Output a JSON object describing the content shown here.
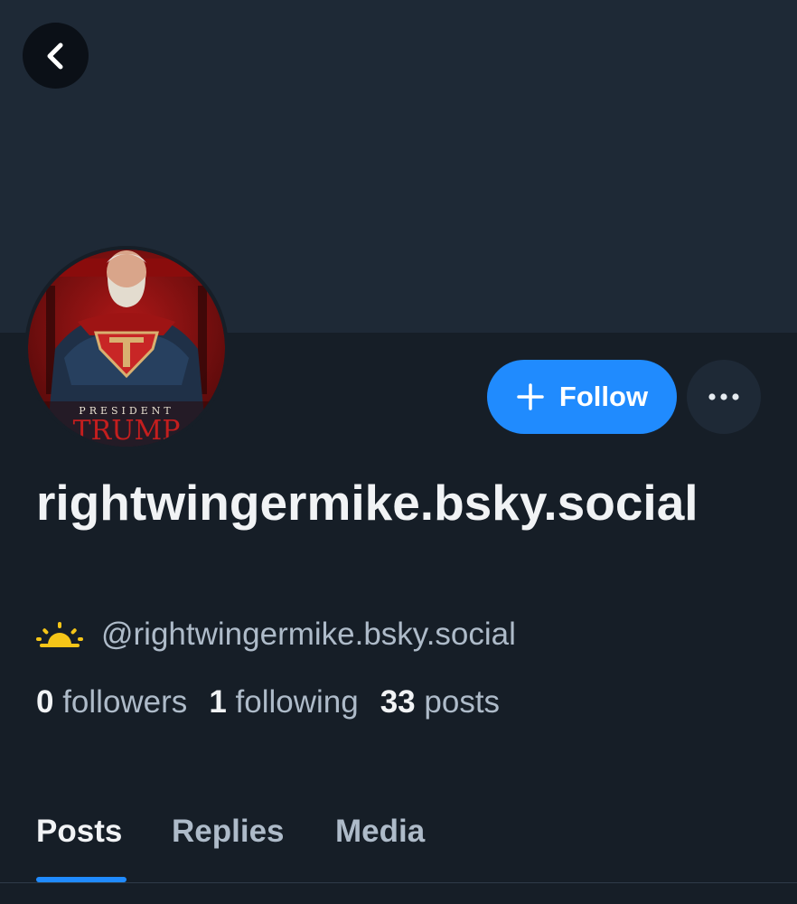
{
  "header": {
    "back_icon": "chevron-left-icon"
  },
  "profile": {
    "avatar": {
      "caption_small": "PRESIDENT",
      "caption_large": "TRUMP",
      "emblem_letter": "T"
    },
    "display_name": "rightwingermike.bsky.social",
    "handle": "@rightwingermike.bsky.social",
    "handle_icon": "sunrise-icon",
    "stats": {
      "followers_count": "0",
      "followers_label": "followers",
      "following_count": "1",
      "following_label": "following",
      "posts_count": "33",
      "posts_label": "posts"
    }
  },
  "actions": {
    "follow_label": "Follow",
    "follow_icon": "plus-icon",
    "more_icon": "ellipsis-icon"
  },
  "tabs": [
    {
      "label": "Posts",
      "active": true
    },
    {
      "label": "Replies",
      "active": false
    },
    {
      "label": "Media",
      "active": false
    }
  ],
  "colors": {
    "accent": "#208bfe",
    "background": "#161e27",
    "banner": "#1e2936",
    "text_primary": "#f1f3f5",
    "text_secondary": "#aebbc9",
    "sun": "#f5c518"
  }
}
